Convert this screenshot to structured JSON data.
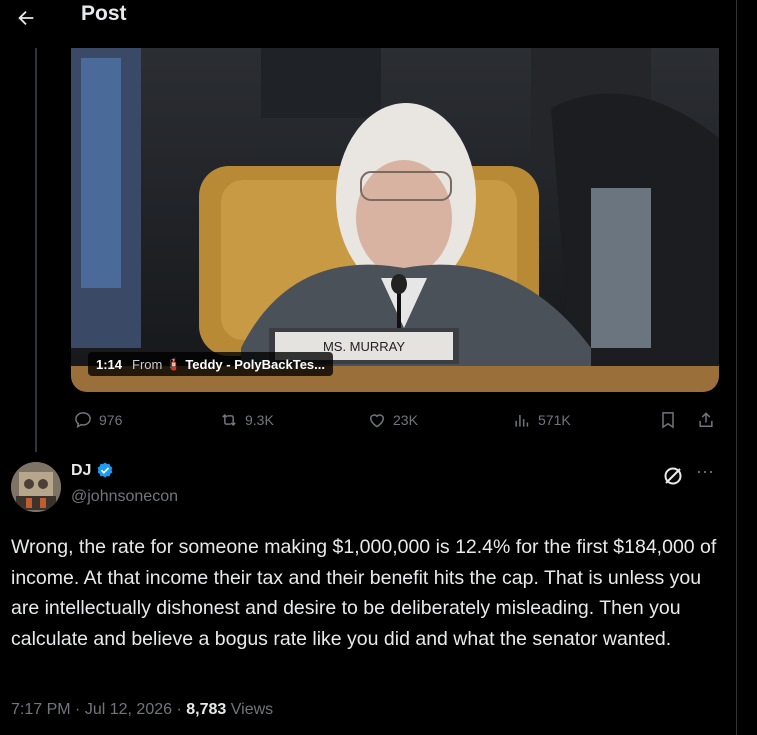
{
  "header": {
    "title": "Post"
  },
  "media": {
    "duration": "1:14",
    "from_label": "From",
    "source_name": "Teddy - PolyBackTes...",
    "nameplate": "MS. MURRAY"
  },
  "actions": {
    "replies": "976",
    "reposts": "9.3K",
    "likes": "23K",
    "views": "571K"
  },
  "reply": {
    "name": "DJ",
    "handle": "@johnsonecon",
    "text": "Wrong, the rate for someone making $1,000,000 is 12.4% for the first $184,000 of income. At that income their tax and their benefit hits the cap. That is unless you are intellectually dishonest and desire to be deliberately misleading. Then you calculate and believe a bogus rate like you did and what the senator wanted.",
    "time": "7:17 PM",
    "date": "Jul 12, 2026",
    "views_count": "8,783",
    "views_label": "Views"
  },
  "colors": {
    "background": "#000000",
    "text": "#e7e9ea",
    "muted": "#71767b",
    "verified": "#1d9bf0",
    "divider": "#2f3336"
  }
}
